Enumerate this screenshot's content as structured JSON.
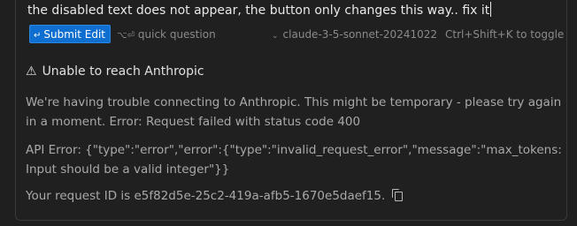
{
  "input": {
    "text": "the disabled text does not appear, the button only changes this way.. fix it"
  },
  "toolbar": {
    "submit_label": "Submit Edit",
    "submit_icon": "↵",
    "quick_icon": "⌥⏎",
    "quick_label": "quick question",
    "model_chevron": "⌄",
    "model_name": "claude-3-5-sonnet-20241022",
    "shortcut_text": "Ctrl+Shift+K to toggle",
    "accent_color": "#0f6fd1"
  },
  "error": {
    "warning_icon": "⚠",
    "title": "Unable to reach Anthropic",
    "message": "We're having trouble connecting to Anthropic. This might be temporary - please try again in a moment. Error: Request failed with status code 400",
    "api_error": "API Error: {\"type\":\"error\",\"error\":{\"type\":\"invalid_request_error\",\"message\":\"max_tokens: Input should be a valid integer\"}}",
    "request_id_text": "Your request ID is e5f82d5e-25c2-419a-afb5-1670e5daef15."
  }
}
